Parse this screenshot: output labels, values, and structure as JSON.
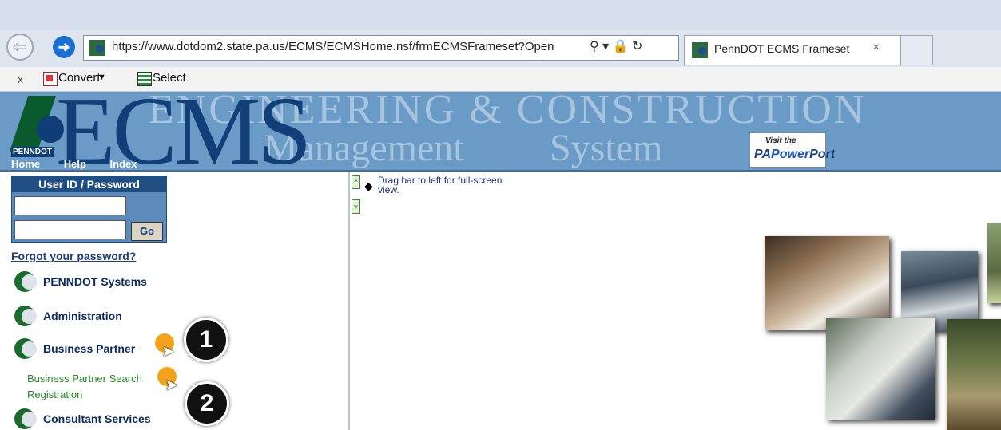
{
  "browser": {
    "url": "https://www.dotdom2.state.pa.us/ECMS/ECMSHome.nsf/frmECMSFrameset?Open",
    "url_controls": "⚲ ▾ 🔒 ↻",
    "tab_title": "PennDOT ECMS Frameset",
    "tab_close": "×",
    "back_icon": "⇦",
    "forward_icon": "➜"
  },
  "toolbar": {
    "close": "x",
    "convert_label": "Convert",
    "dropdown_arrow": "▼",
    "select_label": "Select"
  },
  "header": {
    "logo_text": "PENNDOT",
    "title": "ECMS",
    "tagline_line1": "ENGINEERING & CONSTRUCTION",
    "tagline_line2a": "Management",
    "tagline_line2b": "System",
    "nav": [
      "Home",
      "Help",
      "Index"
    ],
    "portal_visit": "Visit the",
    "portal_pa": "PA",
    "portal_power": "Power",
    "portal_port": "Port"
  },
  "login": {
    "header": "User ID / Password",
    "user_value": "",
    "password_value": "",
    "go_label": "Go",
    "forgot_label": "Forgot your password?"
  },
  "nav_items": [
    {
      "label": "PENNDOT Systems"
    },
    {
      "label": "Administration"
    },
    {
      "label": "Business Partner"
    },
    {
      "label": "Consultant Services"
    }
  ],
  "sub_links": [
    {
      "label": "Business Partner Search"
    },
    {
      "label": "Registration"
    }
  ],
  "callouts": [
    "1",
    "2"
  ],
  "content": {
    "up_arrow": "^",
    "down_arrow": "v",
    "drag_arrow": "◆",
    "drag_hint": "Drag bar to left for full-screen view."
  },
  "colors": {
    "banner": "#6a9bc7",
    "ecms_text": "#123f78",
    "login_header": "#1f4f82",
    "callout_badge": "#f2a31a",
    "sublink": "#2a8a2a"
  }
}
